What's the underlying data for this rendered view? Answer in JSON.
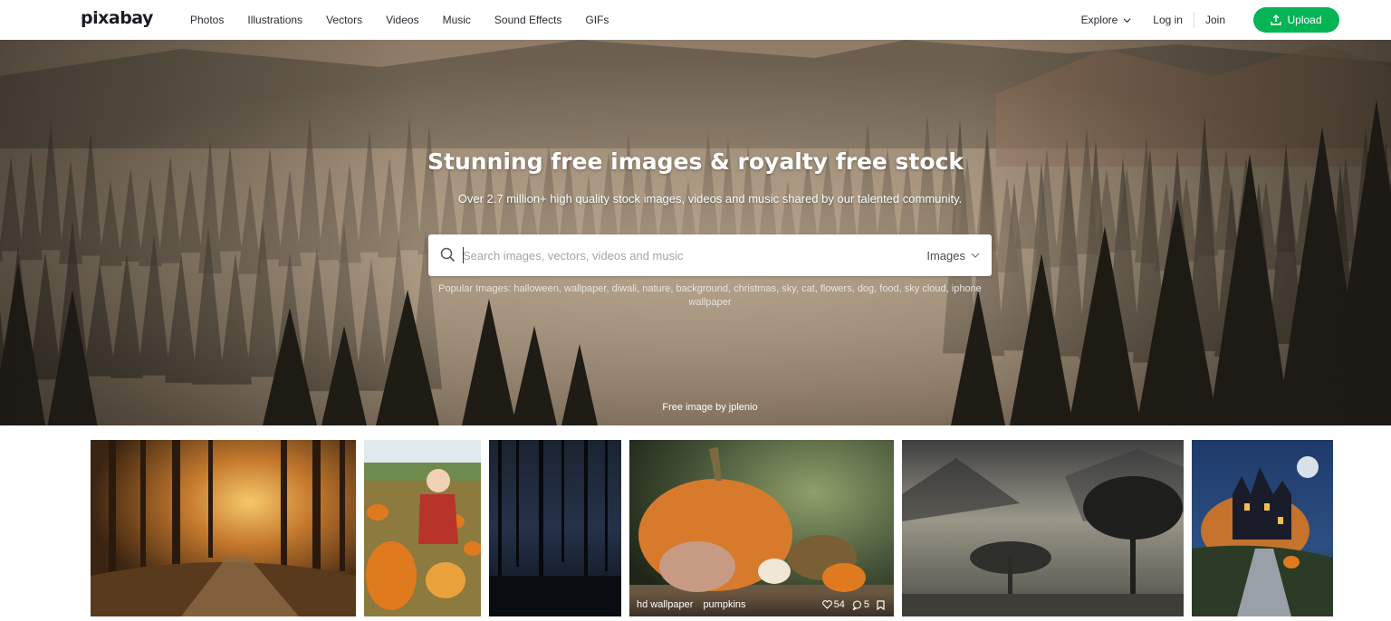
{
  "header": {
    "logo": "pixabay",
    "nav": [
      "Photos",
      "Illustrations",
      "Vectors",
      "Videos",
      "Music",
      "Sound Effects",
      "GIFs"
    ],
    "explore": "Explore",
    "login": "Log in",
    "join": "Join",
    "upload": "Upload",
    "accent_color": "#05b455"
  },
  "hero": {
    "title": "Stunning free images & royalty free stock",
    "subtitle": "Over 2.7 million+ high quality stock images, videos and music shared by our talented community.",
    "search": {
      "placeholder": "Search images, vectors, videos and music",
      "type": "Images",
      "icon": "search-icon"
    },
    "popular": {
      "label": "Popular Images:",
      "tags": "halloween, wallpaper, diwali, nature, background, christmas, sky, cat, flowers, dog, food, sky cloud, iphone wallpaper"
    },
    "credit": "Free image by jplenio"
  },
  "gallery": {
    "tiles": [
      {
        "subject": "autumn forest path"
      },
      {
        "subject": "child in pumpkin patch"
      },
      {
        "subject": "dark foggy forest"
      },
      {
        "subject": "pumpkins",
        "tags": [
          "hd wallpaper",
          "pumpkins"
        ],
        "likes": "54",
        "comments": "5"
      },
      {
        "subject": "foggy tree landscape"
      },
      {
        "subject": "halloween haunted house"
      }
    ]
  }
}
